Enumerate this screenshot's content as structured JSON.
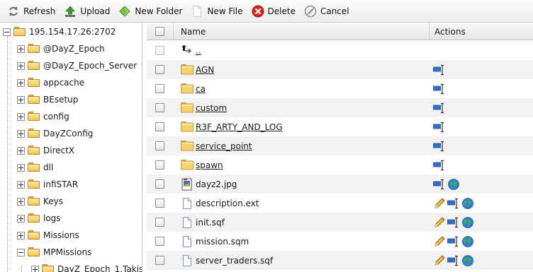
{
  "toolbar": {
    "refresh_label": "Refresh",
    "upload_label": "Upload",
    "new_folder_label": "New Folder",
    "new_file_label": "New File",
    "delete_label": "Delete",
    "cancel_label": "Cancel"
  },
  "tree": {
    "root_label": "195.154.17.26:2702",
    "items": [
      {
        "label": "@DayZ_Epoch",
        "expander": "plus"
      },
      {
        "label": "@DayZ_Epoch_Server",
        "expander": "plus"
      },
      {
        "label": "appcache",
        "expander": "plus"
      },
      {
        "label": "BEsetup",
        "expander": "plus"
      },
      {
        "label": "config",
        "expander": "plus"
      },
      {
        "label": "DayZConfig",
        "expander": "plus"
      },
      {
        "label": "DirectX",
        "expander": "plus"
      },
      {
        "label": "dll",
        "expander": "plus"
      },
      {
        "label": "infiSTAR",
        "expander": "plus"
      },
      {
        "label": "Keys",
        "expander": "plus"
      },
      {
        "label": "logs",
        "expander": "plus"
      },
      {
        "label": "Missions",
        "expander": "plus"
      },
      {
        "label": "MPMissions",
        "expander": "minus"
      }
    ],
    "child_item": {
      "label": "DayZ_Epoch_1.Takis",
      "expander": "plus"
    }
  },
  "grid": {
    "header": {
      "name": "Name",
      "actions": "Actions"
    },
    "rows": [
      {
        "name": "..",
        "type": "up",
        "actions": []
      },
      {
        "name": "AGN",
        "type": "folder",
        "actions": [
          "rename-icon"
        ]
      },
      {
        "name": "ca",
        "type": "folder",
        "actions": [
          "rename-icon"
        ]
      },
      {
        "name": "custom",
        "type": "folder",
        "actions": [
          "rename-icon"
        ]
      },
      {
        "name": "R3F_ARTY_AND_LOG",
        "type": "folder",
        "actions": [
          "rename-icon"
        ]
      },
      {
        "name": "service_point",
        "type": "folder",
        "actions": [
          "rename-icon"
        ]
      },
      {
        "name": "spawn",
        "type": "folder",
        "actions": [
          "rename-icon"
        ]
      },
      {
        "name": "dayz2.jpg",
        "type": "image",
        "actions": [
          "rename-icon",
          "globe-icon"
        ]
      },
      {
        "name": "description.ext",
        "type": "file",
        "actions": [
          "edit-icon",
          "rename-icon",
          "globe-icon"
        ]
      },
      {
        "name": "init.sqf",
        "type": "file",
        "actions": [
          "edit-icon",
          "rename-icon",
          "globe-icon"
        ]
      },
      {
        "name": "mission.sqm",
        "type": "file",
        "actions": [
          "edit-icon",
          "rename-icon",
          "globe-icon"
        ]
      },
      {
        "name": "server_traders.sqf",
        "type": "file",
        "actions": [
          "edit-icon",
          "rename-icon",
          "globe-icon"
        ]
      }
    ]
  }
}
